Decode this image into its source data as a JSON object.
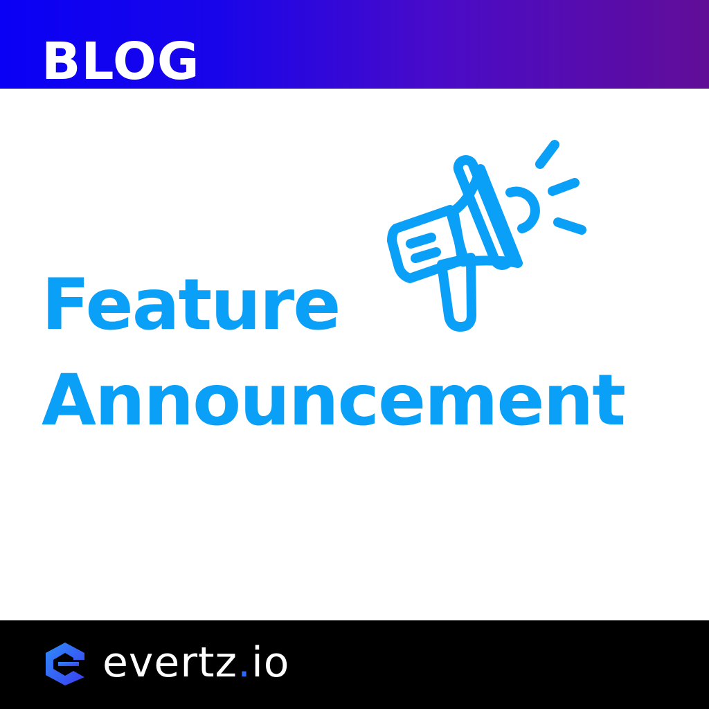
{
  "header": {
    "label": "BLOG"
  },
  "headline": {
    "line1": "Feature",
    "line2": "Announcement"
  },
  "icon": "megaphone-icon",
  "footer": {
    "brand_name": "evertz",
    "brand_dot": ".",
    "brand_tld": "io",
    "logo_icon": "evertz-logo-icon"
  },
  "colors": {
    "accent_blue": "#0aa0f7",
    "banner_start": "#0a00f5",
    "banner_end": "#610d98",
    "footer_bg": "#000000",
    "brand_dot": "#2b6cf6"
  }
}
